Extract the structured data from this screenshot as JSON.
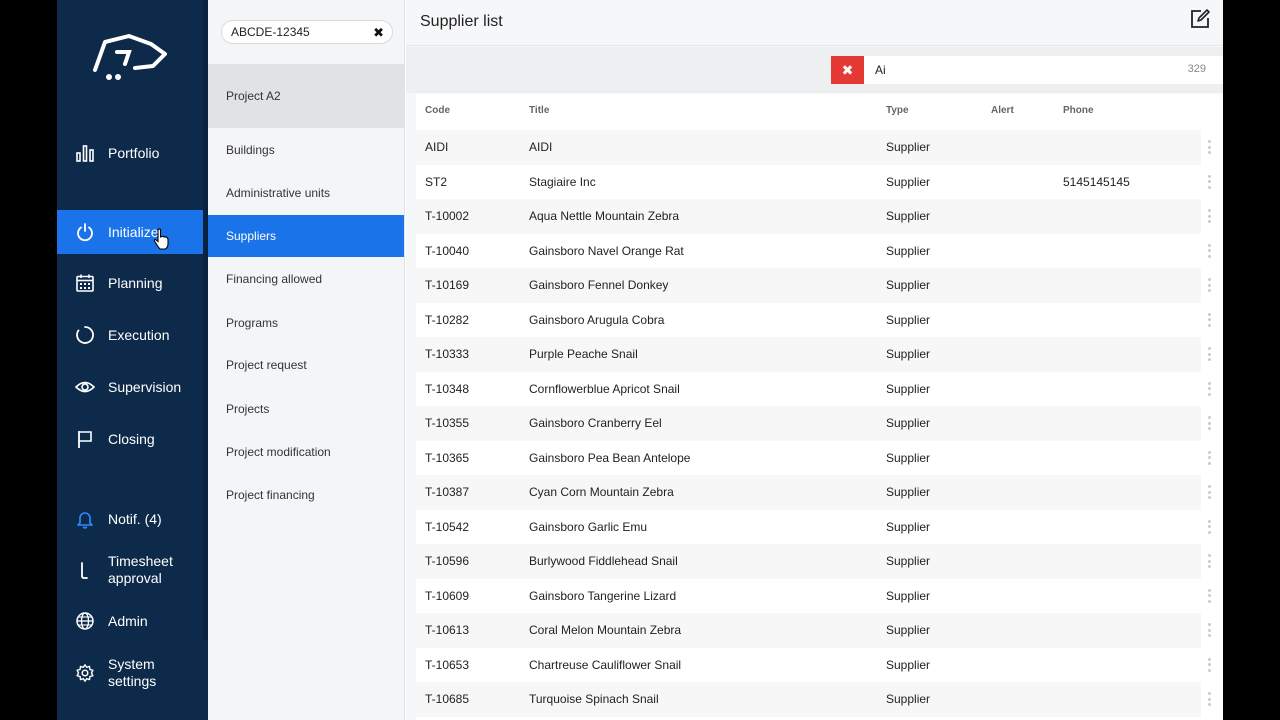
{
  "nav": {
    "items": [
      {
        "label": "Portfolio",
        "icon": "bar-chart-icon"
      },
      {
        "label": "Initialize",
        "icon": "power-icon",
        "active": true
      },
      {
        "label": "Planning",
        "icon": "calendar-icon"
      },
      {
        "label": "Execution",
        "icon": "progress-circle-icon"
      },
      {
        "label": "Supervision",
        "icon": "eye-icon"
      },
      {
        "label": "Closing",
        "icon": "flag-icon"
      },
      {
        "label": "Notif. (4)",
        "icon": "bell-icon"
      },
      {
        "label": "Timesheet approval",
        "icon": "timesheet-icon"
      },
      {
        "label": "Admin",
        "icon": "globe-icon"
      },
      {
        "label": "System settings",
        "icon": "gear-icon"
      }
    ],
    "accent": "#1a73e8",
    "bg": "#0d2a4a"
  },
  "subpanel": {
    "search_value": "ABCDE-12345",
    "current_project": "Project A2",
    "items": [
      {
        "label": "Buildings"
      },
      {
        "label": "Administrative units"
      },
      {
        "label": "Suppliers",
        "active": true
      },
      {
        "label": "Financing allowed"
      },
      {
        "label": "Programs"
      },
      {
        "label": "Project request"
      },
      {
        "label": "Projects"
      },
      {
        "label": "Project modification"
      },
      {
        "label": "Project financing"
      }
    ]
  },
  "main": {
    "title": "Supplier list",
    "filter": {
      "value": "Ai",
      "count": "329",
      "clear_icon": "close-icon"
    },
    "columns": {
      "code": "Code",
      "title": "Title",
      "type": "Type",
      "alert": "Alert",
      "phone": "Phone"
    },
    "rows": [
      {
        "code": "AIDI",
        "title": "AIDI",
        "type": "Supplier",
        "alert": "",
        "phone": ""
      },
      {
        "code": "ST2",
        "title": "Stagiaire Inc",
        "type": "Supplier",
        "alert": "",
        "phone": "5145145145"
      },
      {
        "code": "T-10002",
        "title": "Aqua Nettle Mountain Zebra",
        "type": "Supplier",
        "alert": "",
        "phone": ""
      },
      {
        "code": "T-10040",
        "title": "Gainsboro Navel Orange Rat",
        "type": "Supplier",
        "alert": "",
        "phone": ""
      },
      {
        "code": "T-10169",
        "title": "Gainsboro Fennel Donkey",
        "type": "Supplier",
        "alert": "",
        "phone": ""
      },
      {
        "code": "T-10282",
        "title": "Gainsboro Arugula Cobra",
        "type": "Supplier",
        "alert": "",
        "phone": ""
      },
      {
        "code": "T-10333",
        "title": "Purple Peache Snail",
        "type": "Supplier",
        "alert": "",
        "phone": ""
      },
      {
        "code": "T-10348",
        "title": "Cornflowerblue Apricot Snail",
        "type": "Supplier",
        "alert": "",
        "phone": ""
      },
      {
        "code": "T-10355",
        "title": "Gainsboro Cranberry Eel",
        "type": "Supplier",
        "alert": "",
        "phone": ""
      },
      {
        "code": "T-10365",
        "title": "Gainsboro Pea Bean Antelope",
        "type": "Supplier",
        "alert": "",
        "phone": ""
      },
      {
        "code": "T-10387",
        "title": "Cyan Corn Mountain Zebra",
        "type": "Supplier",
        "alert": "",
        "phone": ""
      },
      {
        "code": "T-10542",
        "title": "Gainsboro Garlic Emu",
        "type": "Supplier",
        "alert": "",
        "phone": ""
      },
      {
        "code": "T-10596",
        "title": "Burlywood Fiddlehead Snail",
        "type": "Supplier",
        "alert": "",
        "phone": ""
      },
      {
        "code": "T-10609",
        "title": "Gainsboro Tangerine Lizard",
        "type": "Supplier",
        "alert": "",
        "phone": ""
      },
      {
        "code": "T-10613",
        "title": "Coral Melon Mountain Zebra",
        "type": "Supplier",
        "alert": "",
        "phone": ""
      },
      {
        "code": "T-10653",
        "title": "Chartreuse Cauliflower Snail",
        "type": "Supplier",
        "alert": "",
        "phone": ""
      },
      {
        "code": "T-10685",
        "title": "Turquoise Spinach Snail",
        "type": "Supplier",
        "alert": "",
        "phone": ""
      }
    ]
  }
}
